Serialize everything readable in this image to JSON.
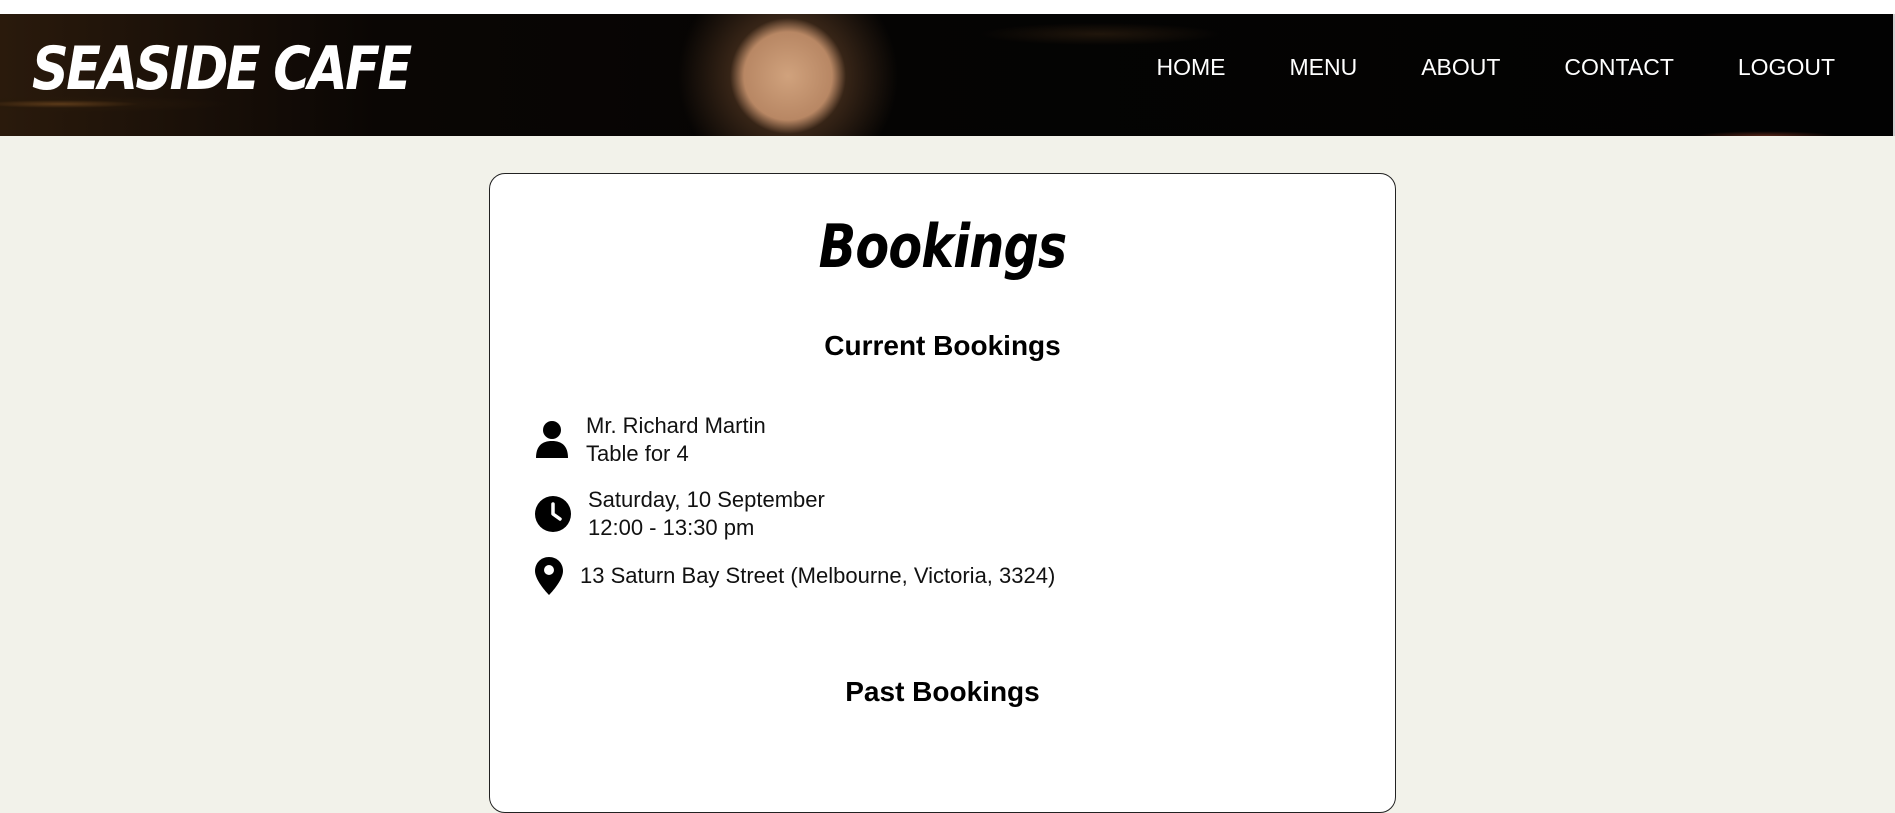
{
  "header": {
    "brand": "SEASIDE CAFE",
    "nav": [
      "HOME",
      "MENU",
      "ABOUT",
      "CONTACT",
      "LOGOUT"
    ]
  },
  "page": {
    "title": "Bookings",
    "current_title": "Current Bookings",
    "past_title": "Past Bookings"
  },
  "booking": {
    "name": "Mr. Richard Martin",
    "table": "Table for 4",
    "date": "Saturday, 10 September",
    "time": "12:00 - 13:30 pm",
    "address": "13 Saturn Bay Street (Melbourne, Victoria, 3324)"
  },
  "icons": {
    "person": "person-icon",
    "clock": "clock-icon",
    "location": "location-pin-icon"
  }
}
